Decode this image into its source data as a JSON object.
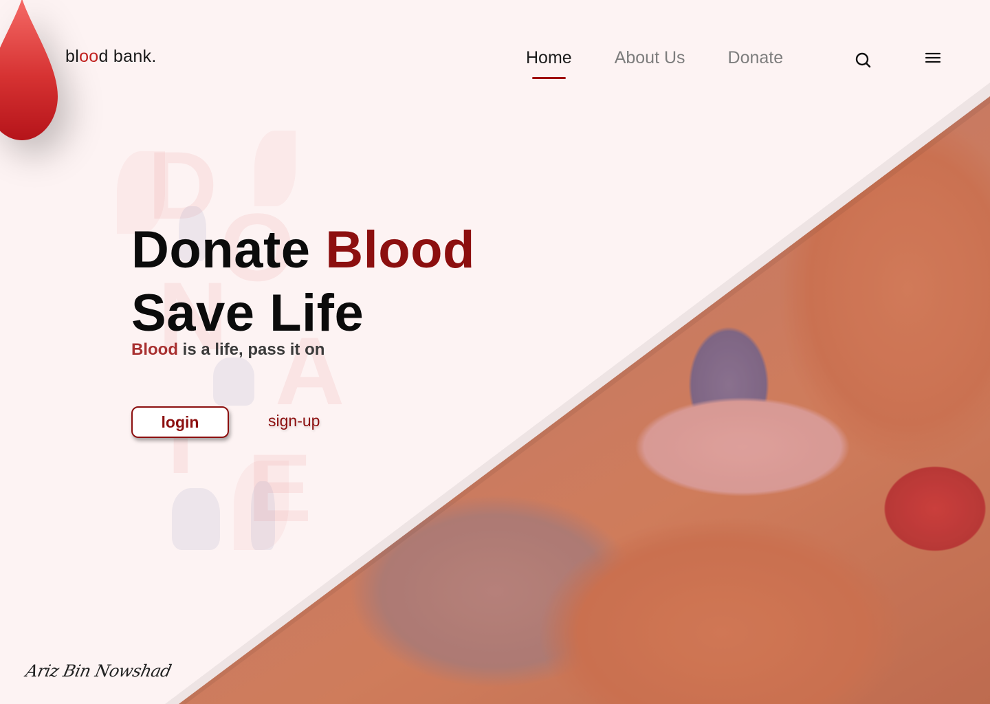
{
  "brand": {
    "prefix": "bl",
    "highlight": "oo",
    "suffix": "d bank."
  },
  "nav": {
    "items": [
      {
        "label": "Home",
        "active": true
      },
      {
        "label": "About Us",
        "active": false
      },
      {
        "label": "Donate",
        "active": false
      }
    ],
    "search_icon": "search-icon",
    "menu_icon": "hamburger-menu-icon"
  },
  "hero": {
    "title_line1_plain": "Donate ",
    "title_line1_accent": "Blood",
    "title_line2": "Save Life",
    "tagline_accent": "Blood",
    "tagline_rest": " is a life, pass it on",
    "login_label": "login",
    "signup_label": "sign-up"
  },
  "signature": "Ariz Bin Nowshad",
  "colors": {
    "accent": "#8c0f0f",
    "background": "#fdf3f3",
    "drop": "#c0201e"
  }
}
